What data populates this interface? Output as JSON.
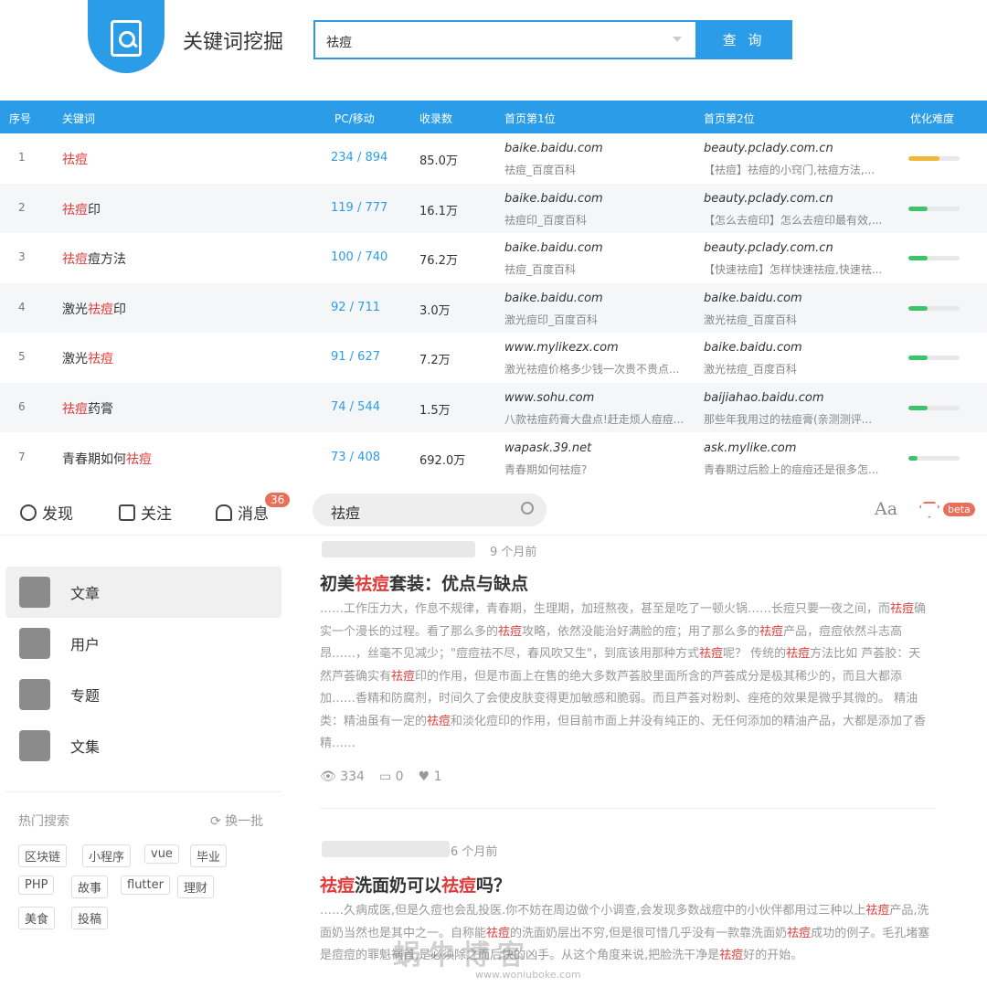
{
  "tool": {
    "title": "关键词挖掘",
    "search_value": "祛痘",
    "query_label": "查 询"
  },
  "table": {
    "headers": [
      "序号",
      "关键词",
      "PC/移动",
      "收录数",
      "首页第1位",
      "首页第2位",
      "优化难度"
    ],
    "rows": [
      {
        "idx": "1",
        "kw_pre": "",
        "kw_hl": "祛痘",
        "kw_post": "",
        "pcm": "234 / 894",
        "count": "85.0万",
        "s1": "baike.baidu.com",
        "s1sub": "祛痘_百度百科",
        "s2": "beauty.pclady.com.cn",
        "s2sub": "【祛痘】祛痘的小窍门,祛痘方法,...",
        "difficulty": 0.6,
        "warn": true
      },
      {
        "idx": "2",
        "kw_pre": "",
        "kw_hl": "祛痘",
        "kw_post": "印",
        "pcm": "119 / 777",
        "count": "16.1万",
        "s1": "baike.baidu.com",
        "s1sub": "祛痘印_百度百科",
        "s2": "beauty.pclady.com.cn",
        "s2sub": "【怎么去痘印】怎么去痘印最有效,...",
        "difficulty": 0.38,
        "warn": false
      },
      {
        "idx": "3",
        "kw_pre": "",
        "kw_hl": "祛痘",
        "kw_post": "痘方法",
        "pcm": "100 / 740",
        "count": "76.2万",
        "s1": "baike.baidu.com",
        "s1sub": "祛痘_百度百科",
        "s2": "beauty.pclady.com.cn",
        "s2sub": "【快速祛痘】怎样快速祛痘,快速祛...",
        "difficulty": 0.38,
        "warn": false
      },
      {
        "idx": "4",
        "kw_pre": "激光",
        "kw_hl": "祛痘",
        "kw_post": "印",
        "pcm": "92 / 711",
        "count": "3.0万",
        "s1": "baike.baidu.com",
        "s1sub": "激光痘印_百度百科",
        "s2": "baike.baidu.com",
        "s2sub": "激光祛痘_百度百科",
        "difficulty": 0.38,
        "warn": false
      },
      {
        "idx": "5",
        "kw_pre": "激光",
        "kw_hl": "祛痘",
        "kw_post": "",
        "pcm": "91 / 627",
        "count": "7.2万",
        "s1": "www.mylikezx.com",
        "s1sub": "激光祛痘价格多少钱一次贵不贵点...",
        "s2": "baike.baidu.com",
        "s2sub": "激光祛痘_百度百科",
        "difficulty": 0.38,
        "warn": false
      },
      {
        "idx": "6",
        "kw_pre": "",
        "kw_hl": "祛痘",
        "kw_post": "药膏",
        "pcm": "74 / 544",
        "count": "1.5万",
        "s1": "www.sohu.com",
        "s1sub": "八款祛痘药膏大盘点!赶走烦人痘痘...",
        "s2": "baijiahao.baidu.com",
        "s2sub": "那些年我用过的祛痘膏(亲测测评...",
        "difficulty": 0.38,
        "warn": false
      },
      {
        "idx": "7",
        "kw_pre": "青春期如何",
        "kw_hl": "祛痘",
        "kw_post": "",
        "pcm": "73 / 408",
        "count": "692.0万",
        "s1": "wapask.39.net",
        "s1sub": "青春期如何祛痘?",
        "s2": "ask.mylike.com",
        "s2sub": "青春期过后脸上的痘痘还是很多怎...",
        "difficulty": 0.18,
        "warn": false
      }
    ]
  },
  "nav": {
    "discover": "发现",
    "follow": "关注",
    "messages": "消息",
    "badge": "36",
    "search_value": "祛痘",
    "font_label": "Aa",
    "beta": "beta"
  },
  "sidebar": {
    "items": [
      "文章",
      "用户",
      "专题",
      "文集"
    ],
    "hot_title": "热门搜索",
    "hot_more": "换一批",
    "tags": [
      "区块链",
      "小程序",
      "vue",
      "毕业",
      "PHP",
      "故事",
      "flutter",
      "理财",
      "美食",
      "投稿"
    ]
  },
  "articles": [
    {
      "time": "9 个月前",
      "title_pre": "初美",
      "title_hl": "祛痘",
      "title_post": "套装：优点与缺点",
      "views": "334",
      "comments": "0",
      "likes": "1"
    },
    {
      "time": "6 个月前",
      "title_hl1": "祛痘",
      "title_mid": "洗面奶可以",
      "title_hl2": "祛痘",
      "title_post": "吗？"
    }
  ],
  "watermark": {
    "text": "蜗牛博客",
    "url": "www.woniuboke.com"
  }
}
